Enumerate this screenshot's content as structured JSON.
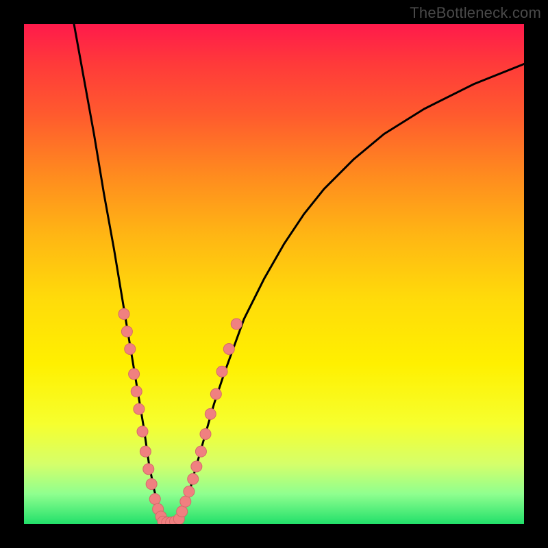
{
  "watermark": "TheBottleneck.com",
  "colors": {
    "curve_stroke": "#000000",
    "marker_fill": "#f08080",
    "marker_stroke": "#d46a6a"
  },
  "chart_data": {
    "type": "line",
    "title": "",
    "xlabel": "",
    "ylabel": "",
    "xlim": [
      0,
      100
    ],
    "ylim": [
      0,
      100
    ],
    "curve": {
      "x": [
        10,
        12,
        14,
        16,
        18,
        20,
        21,
        22,
        23,
        24,
        25,
        26,
        27,
        28,
        29,
        30,
        31,
        32,
        33,
        34,
        36,
        38,
        40,
        44,
        48,
        52,
        56,
        60,
        66,
        72,
        80,
        90,
        100
      ],
      "y": [
        100,
        89,
        78,
        66,
        55,
        43,
        37,
        31,
        25,
        19,
        12,
        7,
        3,
        1,
        0,
        0,
        1,
        3,
        6,
        10,
        17,
        24,
        30,
        41,
        49,
        56,
        62,
        67,
        73,
        78,
        83,
        88,
        92
      ]
    },
    "series": [
      {
        "name": "left-markers",
        "x": [
          20.0,
          20.6,
          21.2,
          22.0,
          22.5,
          23.0,
          23.7,
          24.3,
          24.9,
          25.5,
          26.2,
          26.8,
          27.4
        ],
        "y": [
          42.0,
          38.5,
          35.0,
          30.0,
          26.5,
          23.0,
          18.5,
          14.5,
          11.0,
          8.0,
          5.0,
          3.0,
          1.5
        ]
      },
      {
        "name": "bottom-markers",
        "x": [
          27.8,
          28.6,
          29.4,
          30.2,
          31.0
        ],
        "y": [
          0.5,
          0.3,
          0.3,
          0.5,
          1.0
        ]
      },
      {
        "name": "right-markers",
        "x": [
          31.6,
          32.3,
          33.0,
          33.8,
          34.5,
          35.4,
          36.3,
          37.3,
          38.4,
          39.6,
          41.0,
          42.5
        ],
        "y": [
          2.5,
          4.5,
          6.5,
          9.0,
          11.5,
          14.5,
          18.0,
          22.0,
          26.0,
          30.5,
          35.0,
          40.0
        ]
      }
    ]
  }
}
